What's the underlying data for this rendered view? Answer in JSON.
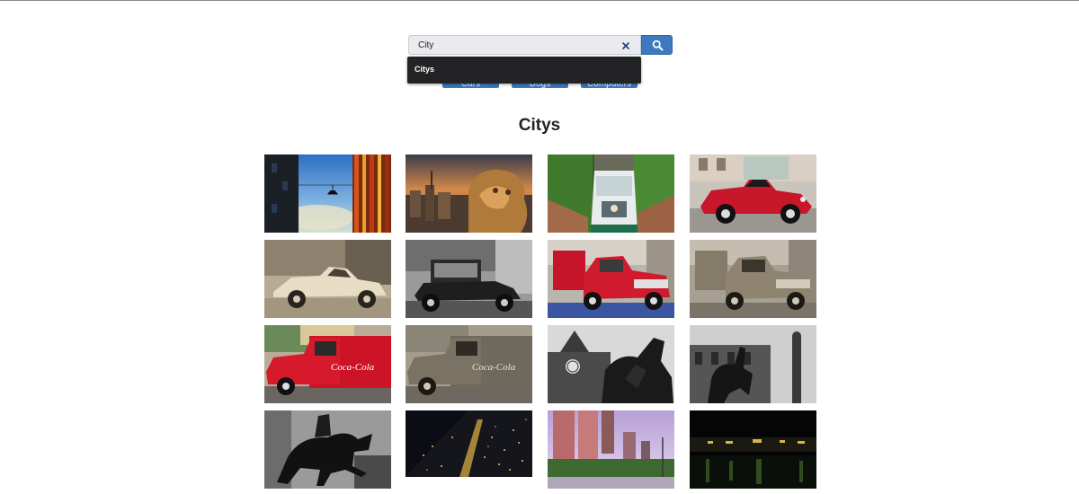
{
  "search": {
    "value": "City",
    "suggestion": "Citys"
  },
  "categories": [
    "Cars",
    "Dogs",
    "Computers"
  ],
  "gallery": {
    "title": "Citys",
    "photos": [
      "building-lamp-photo",
      "gargoyle-cityscape-photo",
      "funicular-tram-photo",
      "red-vintage-car-photo",
      "sepia-vintage-car-photo",
      "bw-vintage-car-photo",
      "red-pickup-truck-photo",
      "sepia-pickup-truck-photo",
      "coca-cola-truck-photo",
      "sepia-coca-cola-truck-photo",
      "clock-tower-statue-photo",
      "equestrian-statue-photo",
      "horse-statue-photo",
      "night-city-aerial-photo",
      "high-rise-street-photo",
      "night-harbor-photo"
    ]
  },
  "colors": {
    "accent": "#3c79bf",
    "dropdown_bg": "#232326",
    "text": "#222222"
  }
}
